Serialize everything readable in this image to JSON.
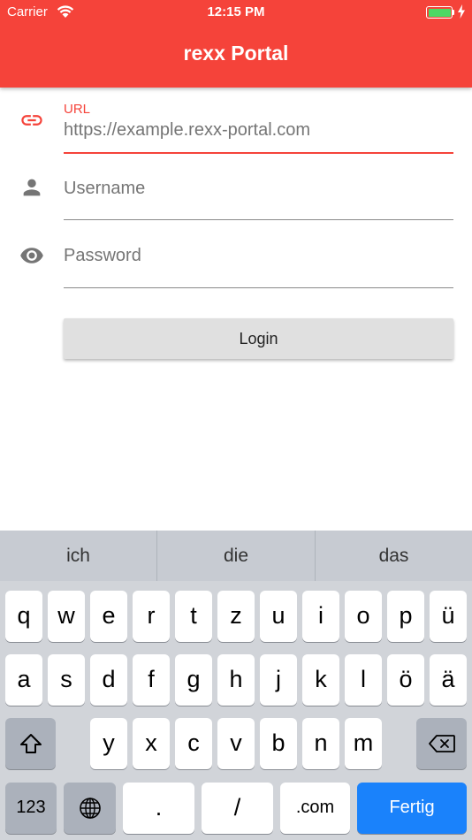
{
  "status_bar": {
    "carrier": "Carrier",
    "time": "12:15 PM",
    "battery_color": "#4cd964"
  },
  "app_bar": {
    "title": "rexx Portal",
    "color": "#f5433a"
  },
  "form": {
    "url": {
      "icon": "link-icon",
      "label": "URL",
      "value": "https://example.rexx-portal.com"
    },
    "username": {
      "icon": "person-icon",
      "placeholder": "Username"
    },
    "password": {
      "icon": "eye-icon",
      "placeholder": "Password"
    },
    "login_label": "Login"
  },
  "keyboard": {
    "suggestions": [
      "ich",
      "die",
      "das"
    ],
    "rows": [
      [
        "q",
        "w",
        "e",
        "r",
        "t",
        "z",
        "u",
        "i",
        "o",
        "p",
        "ü"
      ],
      [
        "a",
        "s",
        "d",
        "f",
        "g",
        "h",
        "j",
        "k",
        "l",
        "ö",
        "ä"
      ],
      [
        "y",
        "x",
        "c",
        "v",
        "b",
        "n",
        "m"
      ]
    ],
    "numbers_label": "123",
    "period_label": ".",
    "slash_label": "/",
    "dotcom_label": ".com",
    "return_label": "Fertig",
    "accent_color": "#1a82fb"
  }
}
